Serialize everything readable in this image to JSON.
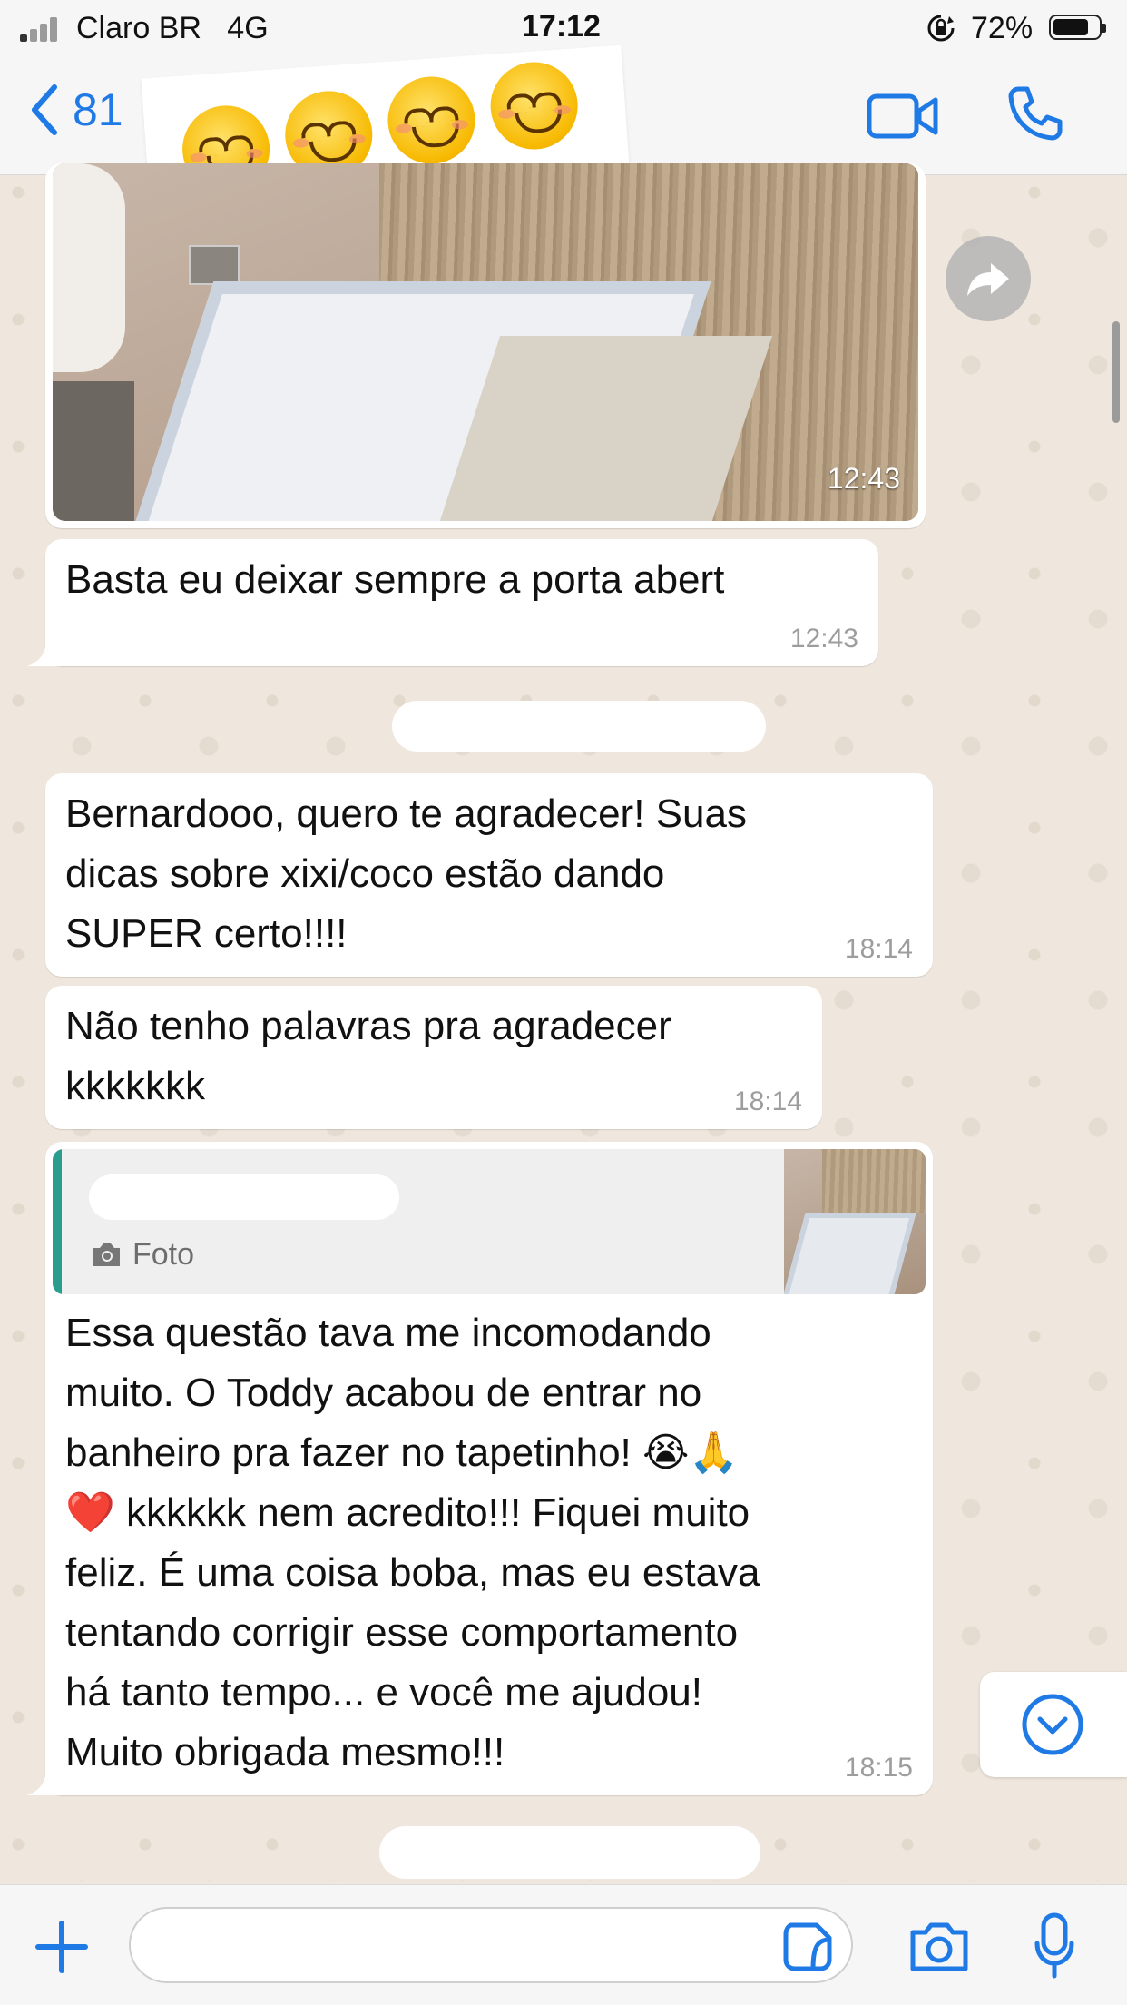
{
  "status_bar": {
    "carrier": "Claro BR",
    "network": "4G",
    "time": "17:12",
    "battery_percent": "72%"
  },
  "header": {
    "back_label": "81",
    "sticker_emoji": [
      "smiling-face",
      "smiling-face",
      "smiling-face",
      "smiling-face"
    ],
    "accent_color": "#1f7ae6"
  },
  "messages": [
    {
      "type": "image",
      "time": "12:43"
    },
    {
      "type": "text",
      "text": "Basta eu deixar sempre a porta abert",
      "time": "12:43"
    },
    {
      "type": "text",
      "text": "Bernardooo, quero te agradecer! Suas\ndicas sobre xixi/coco estão dando\nSUPER certo!!!!",
      "time": "18:14"
    },
    {
      "type": "text",
      "text": "Não tenho palavras pra agradecer\nkkkkkkk",
      "time": "18:14"
    },
    {
      "type": "reply",
      "quote_label": "Foto",
      "text": "Essa questão tava me incomodando\nmuito. O Toddy acabou de entrar no\nbanheiro pra fazer no tapetinho! 😭🙏\n❤️ kkkkkk nem acredito!!! Fiquei muito\nfeliz. É uma coisa boba, mas eu estava\ntentando corrigir esse comportamento\nhá tanto tempo... e você me ajudou!\nMuito obrigada mesmo!!!",
      "time": "18:15"
    }
  ],
  "input_bar": {
    "placeholder": ""
  },
  "colors": {
    "wallpaper": "#efe7dd",
    "bubble": "#ffffff",
    "quote_bar": "#2a9d8f"
  }
}
